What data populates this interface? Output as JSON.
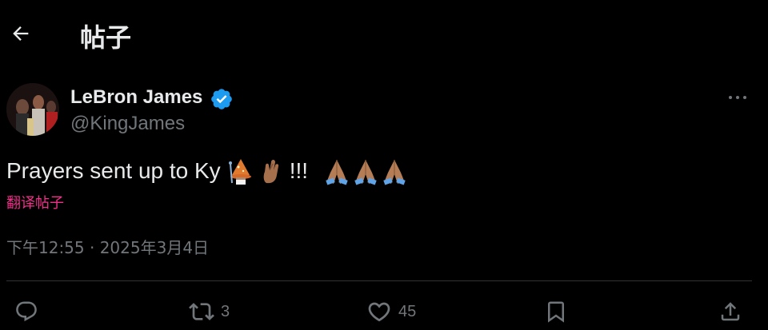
{
  "header": {
    "back_icon": "arrow-left-icon",
    "title": "帖子"
  },
  "post": {
    "author": {
      "name": "LeBron James",
      "handle": "@KingJames",
      "verified": true,
      "verified_color": "#1d9bf0"
    },
    "text": "Prayers sent up to Ky",
    "emojis": [
      "wizard-emoji",
      "crossed-fingers-emoji"
    ],
    "exclaim": "!!!",
    "trailing_emojis": [
      "folded-hands-emoji",
      "folded-hands-emoji",
      "folded-hands-emoji"
    ],
    "translate_label": "翻译帖子",
    "translate_color": "#f0308a",
    "timestamp": "下午12:55 · 2025年3月4日"
  },
  "actions": {
    "reply": {
      "icon": "reply-icon",
      "count": ""
    },
    "repost": {
      "icon": "repost-icon",
      "count": "3"
    },
    "like": {
      "icon": "heart-icon",
      "count": "45"
    },
    "bookmark": {
      "icon": "bookmark-icon",
      "count": ""
    },
    "share": {
      "icon": "share-icon",
      "count": ""
    }
  },
  "colors": {
    "background": "#000000",
    "text_primary": "#e7e9ea",
    "text_secondary": "#71767b",
    "divider": "#2f3336"
  }
}
